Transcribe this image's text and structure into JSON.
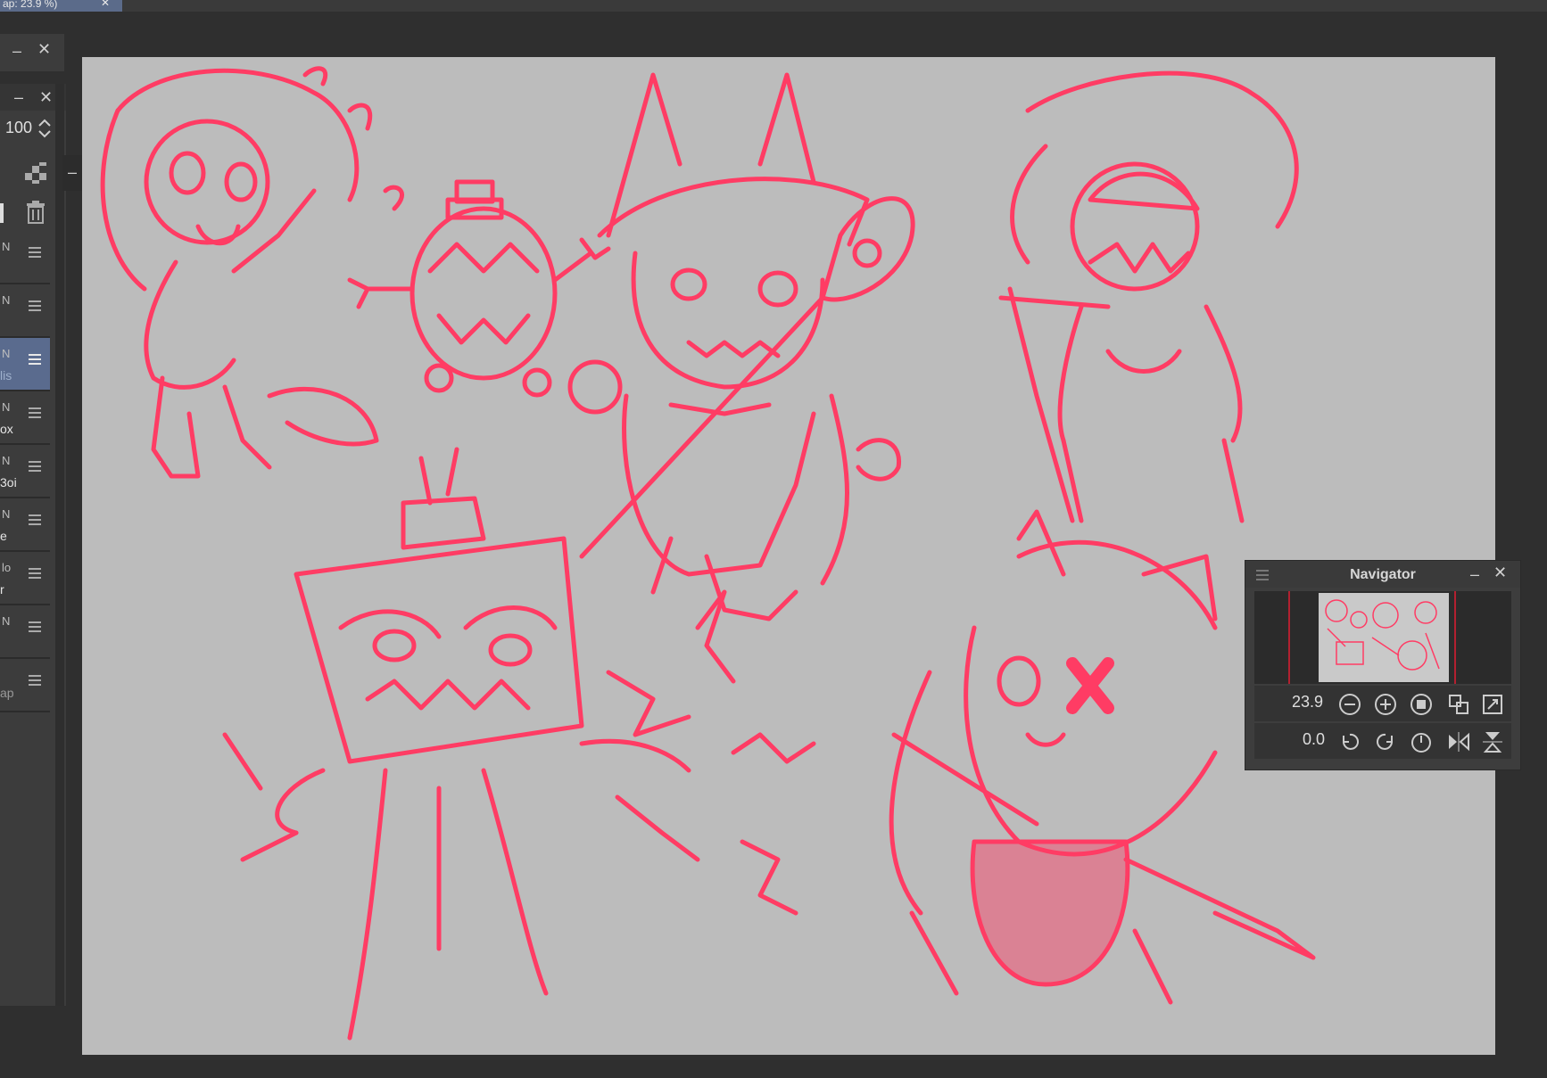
{
  "document_tab": {
    "title": "ap: 23.9 %)",
    "close": "✕"
  },
  "layers_panel": {
    "opacity_value": "100",
    "layers": [
      {
        "name": "N",
        "sub": ""
      },
      {
        "name": "N",
        "sub": ""
      },
      {
        "name": "N",
        "sub": "lis"
      },
      {
        "name": "N",
        "sub": "ox"
      },
      {
        "name": "N",
        "sub": "3oi"
      },
      {
        "name": "N",
        "sub": "e"
      },
      {
        "name": "lo",
        "sub": "r"
      },
      {
        "name": "N",
        "sub": ""
      },
      {
        "name": "",
        "sub": "ap"
      }
    ]
  },
  "navigator": {
    "title": "Navigator",
    "zoom_value": "23.9",
    "rotation_value": "0.0"
  },
  "colors": {
    "sketch": "#ff3c64",
    "canvas": "#bcbcbc",
    "selection": "#5a6b8e"
  }
}
